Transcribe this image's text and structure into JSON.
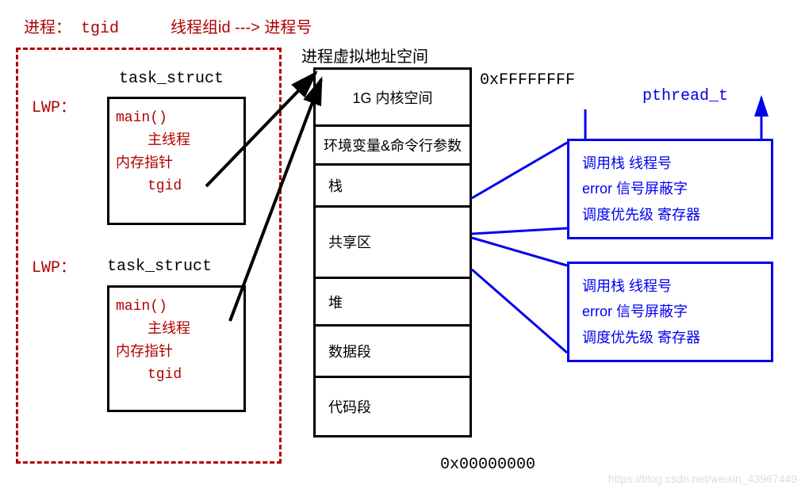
{
  "top": {
    "process_label": "进程：",
    "tgid": "tgid",
    "thread_group_arrow": "线程组id ---> 进程号"
  },
  "lwp1_label": "LWP：",
  "lwp2_label": "LWP：",
  "task_struct_label1": "task_struct",
  "task_struct_label2": "task_struct",
  "ts1": {
    "line1": "main()",
    "line2": "主线程",
    "line3": "内存指针",
    "line4": "tgid"
  },
  "ts2": {
    "line1": "main()",
    "line2": "主线程",
    "line3": "内存指针",
    "line4": "tgid"
  },
  "mem": {
    "title": "进程虚拟地址空间",
    "addr_high": "0xFFFFFFFF",
    "addr_low": "0x00000000",
    "segments": [
      "1G 内核空间",
      "环境变量&命令行参数",
      "栈",
      "共享区",
      "堆",
      "数据段",
      "代码段"
    ]
  },
  "pthread_label": "pthread_t",
  "blue1": {
    "l1": "调用栈  线程号",
    "l2": "error  信号屏蔽字",
    "l3": "调度优先级  寄存器"
  },
  "blue2": {
    "l1": "调用栈  线程号",
    "l2": "error  信号屏蔽字",
    "l3": "调度优先级  寄存器"
  },
  "watermark": "https://blog.csdn.net/weixin_43967449"
}
